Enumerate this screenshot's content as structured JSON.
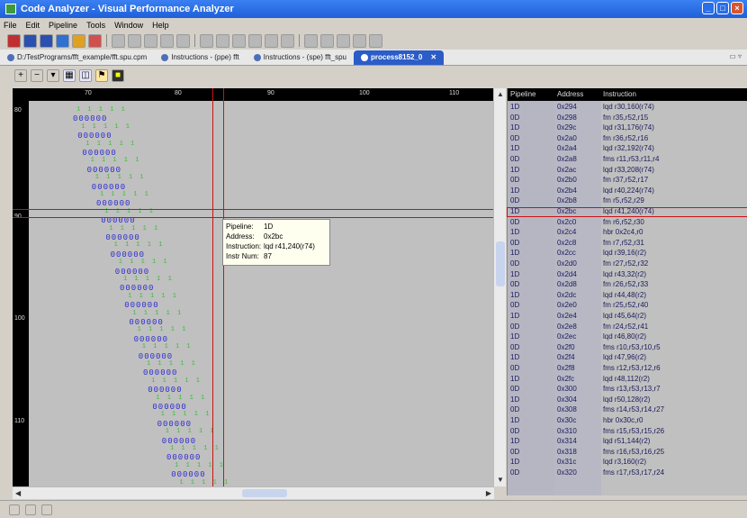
{
  "window": {
    "title": "Code Analyzer - Visual Performance Analyzer"
  },
  "menu": [
    "File",
    "Edit",
    "Pipeline",
    "Tools",
    "Window",
    "Help"
  ],
  "tabs": [
    {
      "label": "D:/TestPrograms/fft_example/fft.spu.cpm",
      "active": false
    },
    {
      "label": "Instructions - (ppe) fft",
      "active": false
    },
    {
      "label": "Instructions - (spe) fft_spu",
      "active": false
    },
    {
      "label": "process8152_0",
      "active": true
    }
  ],
  "ruler": {
    "ticks": [
      "70",
      "80",
      "90",
      "100",
      "110"
    ]
  },
  "leftaxis": {
    "ticks": [
      "80",
      "90",
      "100",
      "110"
    ]
  },
  "glyphs": {
    "blue": "000000",
    "green": "1 1 1 1 1"
  },
  "tooltip": {
    "pipeline_k": "Pipeline:",
    "pipeline_v": "1D",
    "address_k": "Address:",
    "address_v": "0x2bc",
    "instruction_k": "Instruction:",
    "instruction_v": "lqd r41,240(r74)",
    "instrnum_k": "Instr Num:",
    "instrnum_v": "87"
  },
  "table": {
    "headers": [
      "Pipeline",
      "Address",
      "Instruction"
    ],
    "rows": [
      [
        "1D",
        "0x294",
        "lqd r30,160(r74)"
      ],
      [
        "0D",
        "0x298",
        "fm r35,r52,r15"
      ],
      [
        "1D",
        "0x29c",
        "lqd r31,176(r74)"
      ],
      [
        "0D",
        "0x2a0",
        "fm r36,r52,r16"
      ],
      [
        "1D",
        "0x2a4",
        "lqd r32,192(r74)"
      ],
      [
        "0D",
        "0x2a8",
        "fms r11,r53,r11,r4"
      ],
      [
        "1D",
        "0x2ac",
        "lqd r33,208(r74)"
      ],
      [
        "0D",
        "0x2b0",
        "fm r37,r52,r17"
      ],
      [
        "1D",
        "0x2b4",
        "lqd r40,224(r74)"
      ],
      [
        "0D",
        "0x2b8",
        "fm r5,r52,r29"
      ],
      [
        "1D",
        "0x2bc",
        "lqd r41,240(r74)"
      ],
      [
        "0D",
        "0x2c0",
        "fm r6,r52,r30"
      ],
      [
        "1D",
        "0x2c4",
        "hbr 0x2c4,r0"
      ],
      [
        "0D",
        "0x2c8",
        "fm r7,r52,r31"
      ],
      [
        "1D",
        "0x2cc",
        "lqd r39,16(r2)"
      ],
      [
        "0D",
        "0x2d0",
        "fm r27,r52,r32"
      ],
      [
        "1D",
        "0x2d4",
        "lqd r43,32(r2)"
      ],
      [
        "0D",
        "0x2d8",
        "fm r26,r52,r33"
      ],
      [
        "1D",
        "0x2dc",
        "lqd r44,48(r2)"
      ],
      [
        "0D",
        "0x2e0",
        "fm r25,r52,r40"
      ],
      [
        "1D",
        "0x2e4",
        "lqd r45,64(r2)"
      ],
      [
        "0D",
        "0x2e8",
        "fm r24,r52,r41"
      ],
      [
        "1D",
        "0x2ec",
        "lqd r46,80(r2)"
      ],
      [
        "0D",
        "0x2f0",
        "fms r10,r53,r10,r5"
      ],
      [
        "1D",
        "0x2f4",
        "lqd r47,96(r2)"
      ],
      [
        "0D",
        "0x2f8",
        "fms r12,r53,r12,r6"
      ],
      [
        "1D",
        "0x2fc",
        "lqd r48,112(r2)"
      ],
      [
        "0D",
        "0x300",
        "fms r13,r53,r13,r7"
      ],
      [
        "1D",
        "0x304",
        "lqd r50,128(r2)"
      ],
      [
        "0D",
        "0x308",
        "fms r14,r53,r14,r27"
      ],
      [
        "1D",
        "0x30c",
        "hbr 0x30c,r0"
      ],
      [
        "0D",
        "0x310",
        "fms r15,r53,r15,r26"
      ],
      [
        "1D",
        "0x314",
        "lqd r51,144(r2)"
      ],
      [
        "0D",
        "0x318",
        "fms r16,r53,r16,r25"
      ],
      [
        "1D",
        "0x31c",
        "lqd r3,160(r2)"
      ],
      [
        "0D",
        "0x320",
        "fms r17,r53,r17,r24"
      ]
    ],
    "selected_index": 10
  },
  "colors": {
    "accent": "#2b5cc7",
    "highlight": "#cc1111",
    "blue_glyph": "#2d2dd0",
    "green_glyph": "#3cbb3c"
  }
}
